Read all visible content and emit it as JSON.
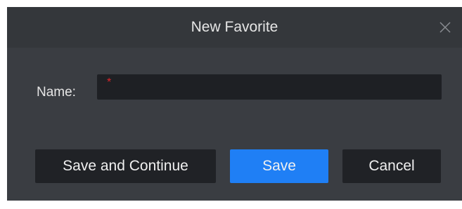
{
  "dialog": {
    "title": "New Favorite",
    "close_icon": "close-icon"
  },
  "form": {
    "name_label": "Name:",
    "name_value": "",
    "required_marker": "*"
  },
  "buttons": {
    "save_and_continue": "Save and Continue",
    "save": "Save",
    "cancel": "Cancel"
  },
  "colors": {
    "dialog_bg": "#3a3d42",
    "titlebar_bg": "#34373b",
    "input_bg": "#1e2024",
    "primary_button": "#1f7ff5",
    "dark_button": "#202226",
    "required_marker": "#e0262b"
  }
}
